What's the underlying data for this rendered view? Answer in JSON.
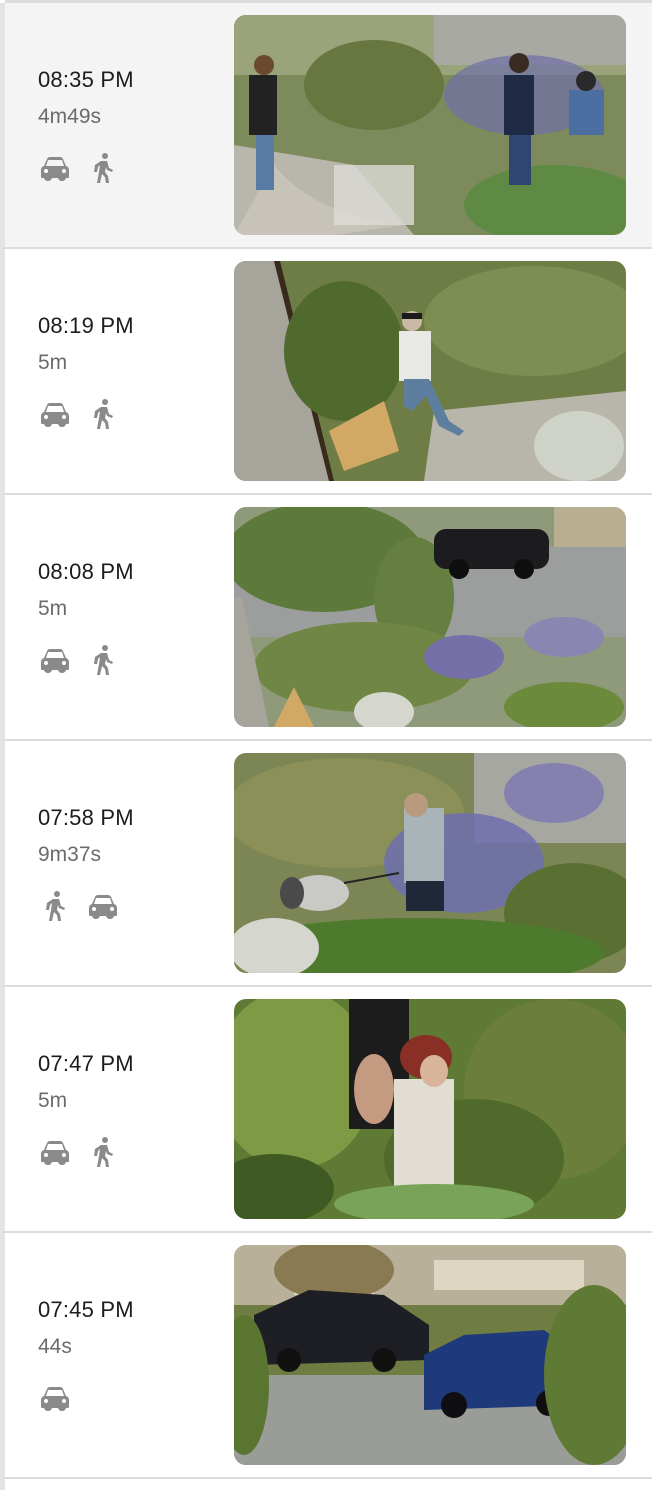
{
  "events": [
    {
      "time": "08:35 PM",
      "duration": "4m49s",
      "icons": [
        "car-icon",
        "person-walking-icon"
      ],
      "selected": true
    },
    {
      "time": "08:19 PM",
      "duration": "5m",
      "icons": [
        "car-icon",
        "person-walking-icon"
      ],
      "selected": false
    },
    {
      "time": "08:08 PM",
      "duration": "5m",
      "icons": [
        "car-icon",
        "person-walking-icon"
      ],
      "selected": false
    },
    {
      "time": "07:58 PM",
      "duration": "9m37s",
      "icons": [
        "person-walking-icon",
        "car-icon"
      ],
      "selected": false
    },
    {
      "time": "07:47 PM",
      "duration": "5m",
      "icons": [
        "car-icon",
        "person-walking-icon"
      ],
      "selected": false
    },
    {
      "time": "07:45 PM",
      "duration": "44s",
      "icons": [
        "car-icon"
      ],
      "selected": false
    }
  ],
  "colors": {
    "icon": "#8a8a8a",
    "divider": "#dcdcdc",
    "selected_bg": "#f4f4f4"
  }
}
